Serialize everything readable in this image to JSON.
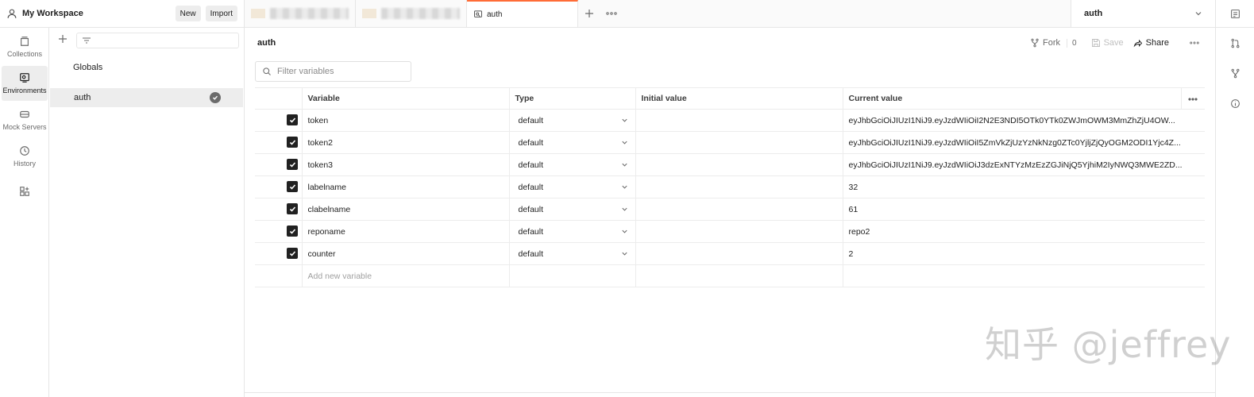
{
  "workspace": {
    "title": "My Workspace",
    "new_label": "New",
    "import_label": "Import"
  },
  "tabs": {
    "active_label": "auth"
  },
  "env_selector": {
    "value": "auth"
  },
  "rail": {
    "items": [
      {
        "label": "Collections",
        "icon": "collections-icon"
      },
      {
        "label": "Environments",
        "icon": "environments-icon"
      },
      {
        "label": "Mock Servers",
        "icon": "mock-servers-icon"
      },
      {
        "label": "History",
        "icon": "history-icon"
      }
    ]
  },
  "sidebar": {
    "items": [
      {
        "label": "Globals"
      },
      {
        "label": "auth"
      }
    ]
  },
  "main": {
    "title": "auth",
    "fork_label": "Fork",
    "fork_count": "0",
    "save_label": "Save",
    "share_label": "Share",
    "filter_placeholder": "Filter variables"
  },
  "table": {
    "columns": [
      "Variable",
      "Type",
      "Initial value",
      "Current value"
    ],
    "rows": [
      {
        "variable": "token",
        "type": "default",
        "initial": "",
        "current": "eyJhbGciOiJIUzI1NiJ9.eyJzdWIiOiI2N2E3NDI5OTk0YTk0ZWJmOWM3MmZhZjU4OW..."
      },
      {
        "variable": "token2",
        "type": "default",
        "initial": "",
        "current": "eyJhbGciOiJIUzI1NiJ9.eyJzdWIiOiI5ZmVkZjUzYzNkNzg0ZTc0YjljZjQyOGM2ODI1Yjc4Z..."
      },
      {
        "variable": "token3",
        "type": "default",
        "initial": "",
        "current": "eyJhbGciOiJIUzI1NiJ9.eyJzdWIiOiJ3dzExNTYzMzEzZGJiNjQ5YjhiM2IyNWQ3MWE2ZD..."
      },
      {
        "variable": "labelname",
        "type": "default",
        "initial": "",
        "current": "32"
      },
      {
        "variable": "clabelname",
        "type": "default",
        "initial": "",
        "current": "61"
      },
      {
        "variable": "reponame",
        "type": "default",
        "initial": "",
        "current": "repo2"
      },
      {
        "variable": "counter",
        "type": "default",
        "initial": "",
        "current": "2"
      }
    ],
    "add_placeholder": "Add new variable"
  },
  "watermark": "知乎 @jeffrey",
  "colors": {
    "accent": "#ff6c37",
    "active_bg": "#ededed",
    "border": "#e6e6e6"
  }
}
